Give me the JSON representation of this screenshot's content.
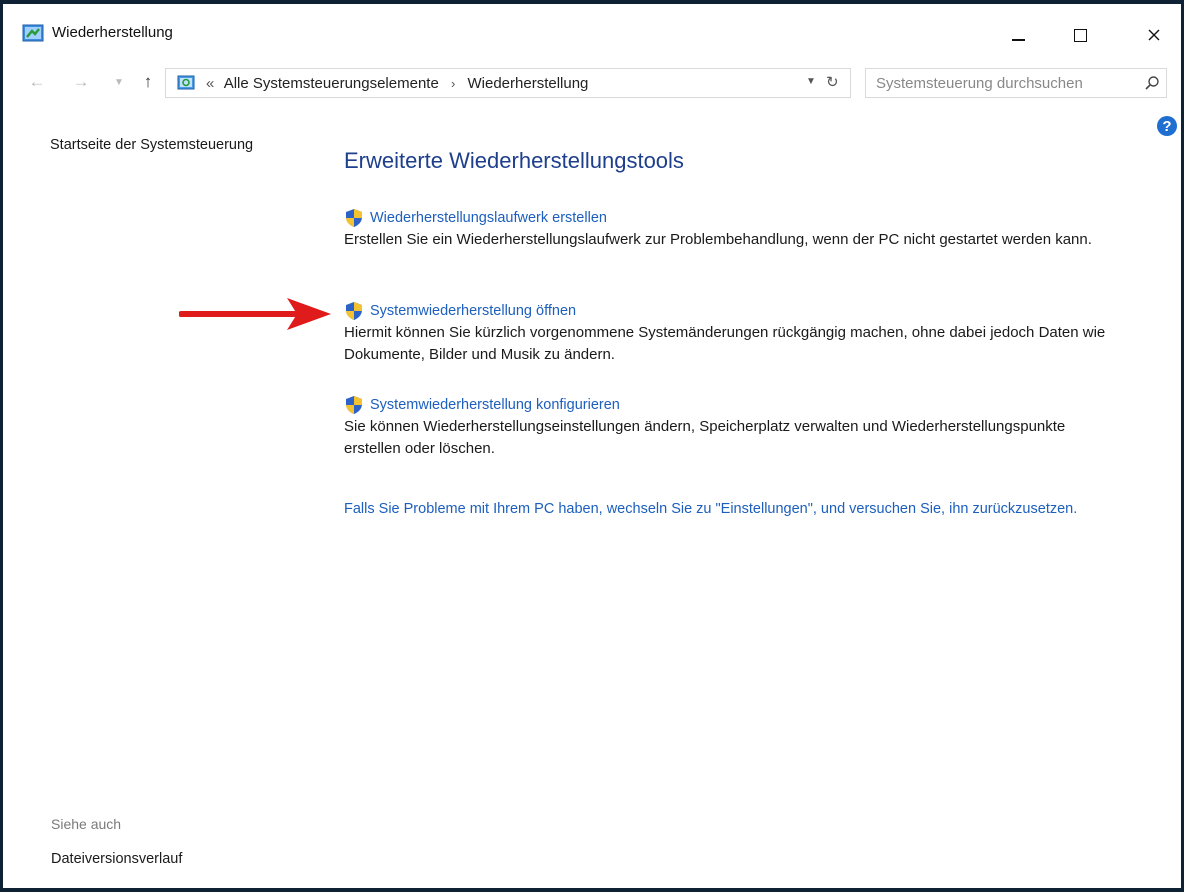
{
  "window": {
    "title": "Wiederherstellung"
  },
  "nav": {
    "breadcrumb_prefix": "«",
    "breadcrumb": [
      "Alle Systemsteuerungselemente",
      "Wiederherstellung"
    ],
    "search_placeholder": "Systemsteuerung durchsuchen"
  },
  "sidebar": {
    "home_link": "Startseite der Systemsteuerung",
    "see_also_label": "Siehe auch",
    "file_history_link": "Dateiversionsverlauf"
  },
  "main": {
    "heading": "Erweiterte Wiederherstellungstools",
    "tasks": [
      {
        "link": "Wiederherstellungslaufwerk erstellen",
        "description": "Erstellen Sie ein Wiederherstellungslaufwerk zur Problembehandlung, wenn der PC nicht gestartet werden kann."
      },
      {
        "link": "Systemwiederherstellung öffnen",
        "description": "Hiermit können Sie kürzlich vorgenommene Systemänderungen rückgängig machen, ohne dabei jedoch Daten wie Dokumente, Bilder und Musik zu ändern."
      },
      {
        "link": "Systemwiederherstellung konfigurieren",
        "description": "Sie können Wiederherstellungseinstellungen ändern, Speicherplatz verwalten und Wiederherstellungspunkte erstellen oder löschen."
      }
    ],
    "reset_link": "Falls Sie Probleme mit Ihrem PC haben, wechseln Sie zu \"Einstellungen\", und versuchen Sie, ihn zurückzusetzen."
  },
  "colors": {
    "link": "#1c5fbd",
    "heading": "#1e3f8c",
    "annotation_arrow": "#e01b1b",
    "desktop_frame": "#0f2135"
  }
}
